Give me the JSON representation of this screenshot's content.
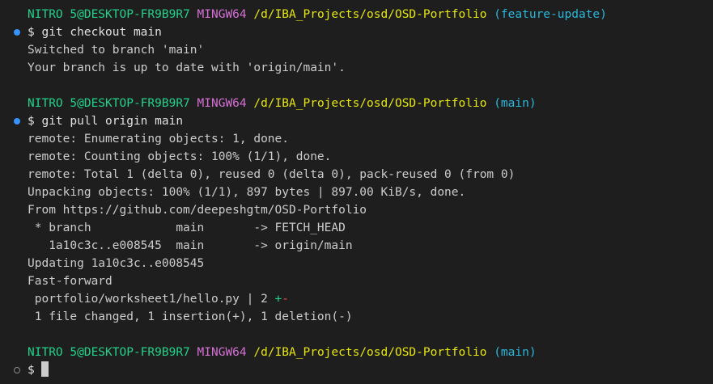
{
  "prompt_host": "NITRO 5@DESKTOP-FR9B9R7",
  "prompt_system": "MINGW64",
  "prompt_path": "/d/IBA_Projects/osd/OSD-Portfolio",
  "blocks": [
    {
      "branch": "(feature-update)",
      "command": "$ git checkout main",
      "output": [
        "Switched to branch 'main'",
        "Your branch is up to date with 'origin/main'."
      ]
    },
    {
      "branch": "(main)",
      "command": "$ git pull origin main",
      "output": [
        "remote: Enumerating objects: 1, done.",
        "remote: Counting objects: 100% (1/1), done.",
        "remote: Total 1 (delta 0), reused 0 (delta 0), pack-reused 0 (from 0)",
        "Unpacking objects: 100% (1/1), 897 bytes | 897.00 KiB/s, done.",
        "From https://github.com/deepeshgtm/OSD-Portfolio",
        " * branch            main       -> FETCH_HEAD",
        "   1a10c3c..e008545  main       -> origin/main",
        "Updating 1a10c3c..e008545",
        "Fast-forward"
      ],
      "diffstat": {
        "file": " portfolio/worksheet1/hello.py | 2 ",
        "plus": "+",
        "minus": "-",
        "summary": " 1 file changed, 1 insertion(+), 1 deletion(-)"
      }
    },
    {
      "branch": "(main)",
      "command": "$ "
    }
  ],
  "colors": {
    "background": "#1e1e1e",
    "host": "#23d18b",
    "system": "#d670d6",
    "path": "#e5e510",
    "branch": "#29b8db",
    "decoration_success": "#3794ff",
    "decoration_idle": "#8a8a8a"
  },
  "icons": {
    "success_decoration": "filled-circle-icon",
    "idle_decoration": "hollow-circle-icon"
  }
}
